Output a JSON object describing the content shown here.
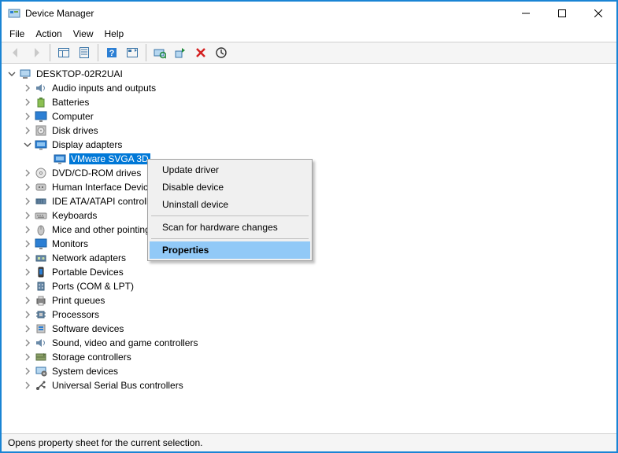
{
  "window": {
    "title": "Device Manager"
  },
  "menu": {
    "file": "File",
    "action": "Action",
    "view": "View",
    "help": "Help"
  },
  "root": {
    "name": "DESKTOP-02R2UAI"
  },
  "categories": [
    {
      "label": "Audio inputs and outputs",
      "expanded": false
    },
    {
      "label": "Batteries",
      "expanded": false
    },
    {
      "label": "Computer",
      "expanded": false
    },
    {
      "label": "Disk drives",
      "expanded": false
    },
    {
      "label": "Display adapters",
      "expanded": true,
      "children": [
        {
          "label": "VMware SVGA 3D",
          "selected": true
        }
      ]
    },
    {
      "label": "DVD/CD-ROM drives",
      "expanded": false
    },
    {
      "label": "Human Interface Devices",
      "expanded": false
    },
    {
      "label": "IDE ATA/ATAPI controllers",
      "expanded": false
    },
    {
      "label": "Keyboards",
      "expanded": false
    },
    {
      "label": "Mice and other pointing devices",
      "expanded": false
    },
    {
      "label": "Monitors",
      "expanded": false
    },
    {
      "label": "Network adapters",
      "expanded": false
    },
    {
      "label": "Portable Devices",
      "expanded": false
    },
    {
      "label": "Ports (COM & LPT)",
      "expanded": false
    },
    {
      "label": "Print queues",
      "expanded": false
    },
    {
      "label": "Processors",
      "expanded": false
    },
    {
      "label": "Software devices",
      "expanded": false
    },
    {
      "label": "Sound, video and game controllers",
      "expanded": false
    },
    {
      "label": "Storage controllers",
      "expanded": false
    },
    {
      "label": "System devices",
      "expanded": false
    },
    {
      "label": "Universal Serial Bus controllers",
      "expanded": false
    }
  ],
  "context_menu": {
    "update": "Update driver",
    "disable": "Disable device",
    "uninstall": "Uninstall device",
    "scan": "Scan for hardware changes",
    "properties": "Properties"
  },
  "status": {
    "text": "Opens property sheet for the current selection."
  },
  "icons": {
    "category_map": {
      "Audio inputs and outputs": "speaker",
      "Batteries": "battery",
      "Computer": "monitor",
      "Disk drives": "disk",
      "Display adapters": "display",
      "DVD/CD-ROM drives": "cd",
      "Human Interface Devices": "hid",
      "IDE ATA/ATAPI controllers": "ide",
      "Keyboards": "keyboard",
      "Mice and other pointing devices": "mouse",
      "Monitors": "monitor",
      "Network adapters": "network",
      "Portable Devices": "portable",
      "Ports (COM & LPT)": "port",
      "Print queues": "printer",
      "Processors": "cpu",
      "Software devices": "software",
      "Sound, video and game controllers": "speaker",
      "Storage controllers": "storage",
      "System devices": "system",
      "Universal Serial Bus controllers": "usb"
    }
  }
}
